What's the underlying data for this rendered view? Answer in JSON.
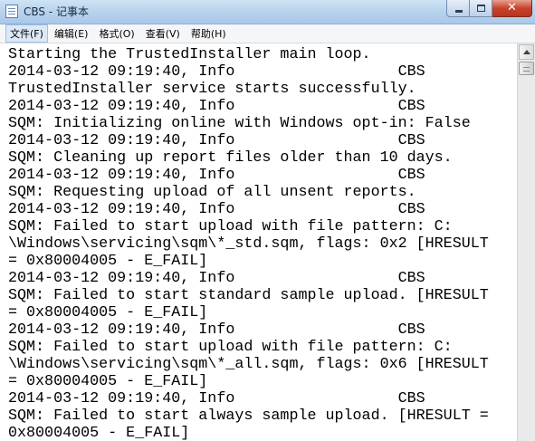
{
  "window": {
    "title": "CBS - 记事本",
    "icon": "notepad-icon",
    "controls": {
      "minimize_icon": "minimize-icon",
      "maximize_icon": "maximize-icon",
      "close_icon": "close-icon",
      "close_glyph": "✕"
    }
  },
  "menu": {
    "items": [
      {
        "label": "文件(F)"
      },
      {
        "label": "编辑(E)"
      },
      {
        "label": "格式(O)"
      },
      {
        "label": "查看(V)"
      },
      {
        "label": "帮助(H)"
      }
    ]
  },
  "document": {
    "lines": [
      "Starting the TrustedInstaller main loop.",
      "2014-03-12 09:19:40, Info                  CBS",
      "TrustedInstaller service starts successfully.",
      "2014-03-12 09:19:40, Info                  CBS",
      "SQM: Initializing online with Windows opt-in: False",
      "2014-03-12 09:19:40, Info                  CBS",
      "SQM: Cleaning up report files older than 10 days.",
      "2014-03-12 09:19:40, Info                  CBS",
      "SQM: Requesting upload of all unsent reports.",
      "2014-03-12 09:19:40, Info                  CBS",
      "SQM: Failed to start upload with file pattern: C:",
      "\\Windows\\servicing\\sqm\\*_std.sqm, flags: 0x2 [HRESULT",
      "= 0x80004005 - E_FAIL]",
      "2014-03-12 09:19:40, Info                  CBS",
      "SQM: Failed to start standard sample upload. [HRESULT",
      "= 0x80004005 - E_FAIL]",
      "2014-03-12 09:19:40, Info                  CBS",
      "SQM: Failed to start upload with file pattern: C:",
      "\\Windows\\servicing\\sqm\\*_all.sqm, flags: 0x6 [HRESULT",
      "= 0x80004005 - E_FAIL]",
      "2014-03-12 09:19:40, Info                  CBS",
      "SQM: Failed to start always sample upload. [HRESULT =",
      "0x80004005 - E_FAIL]"
    ]
  },
  "scrollbar": {
    "up_icon": "scroll-up-arrow-icon",
    "position": 0
  }
}
